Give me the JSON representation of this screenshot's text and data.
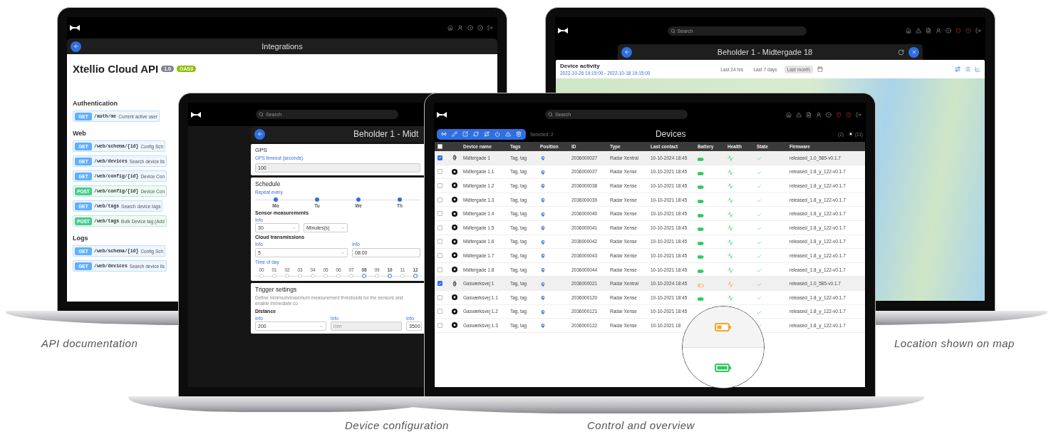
{
  "api_screen": {
    "title": "Integrations",
    "api_name": "Xtellio Cloud API",
    "badges": [
      {
        "text": "1.0",
        "kind": "version"
      },
      {
        "text": "OAS3",
        "kind": "spec"
      }
    ],
    "sections": [
      {
        "title": "Authentication",
        "endpoints": [
          {
            "method": "GET",
            "path": "/auth/me",
            "summary": "Current active user"
          }
        ]
      },
      {
        "title": "Web",
        "endpoints": [
          {
            "method": "GET",
            "path": "/web/schema/{id}",
            "summary": "Config Sch"
          },
          {
            "method": "GET",
            "path": "/web/devices",
            "summary": "Search device lis"
          },
          {
            "method": "GET",
            "path": "/web/config/{id}",
            "summary": "Device Con"
          },
          {
            "method": "POST",
            "path": "/web/config/{id}",
            "summary": "Device Con"
          },
          {
            "method": "GET",
            "path": "/web/tags",
            "summary": "Search device tags"
          },
          {
            "method": "POST",
            "path": "/web/tags",
            "summary": "Bulk Device tag (Add"
          }
        ]
      },
      {
        "title": "Logs",
        "endpoints": [
          {
            "method": "GET",
            "path": "/web/schema/{id}",
            "summary": "Config Sch"
          },
          {
            "method": "GET",
            "path": "/web/devices",
            "summary": "Search device lis"
          }
        ]
      }
    ],
    "caption": "API documentation"
  },
  "config_screen": {
    "search_placeholder": "Search",
    "title": "Beholder 1 - Midt",
    "gps": {
      "heading": "GPS",
      "label": "GPS timeout (seconds)",
      "value": "100",
      "disabled": true
    },
    "schedule": {
      "heading": "Schedule",
      "repeat_label": "Repeat every",
      "days": [
        {
          "label": "Mo",
          "selected": true
        },
        {
          "label": "Tu",
          "selected": true
        },
        {
          "label": "We",
          "selected": true
        },
        {
          "label": "Th",
          "selected": true
        }
      ],
      "sensor_heading": "Sensor measurements",
      "sensor_fields": [
        {
          "label": "Info",
          "value": "30",
          "kind": "select"
        },
        {
          "value": "Minutes(s)",
          "kind": "select"
        }
      ],
      "cloud_heading": "Cloud transmissions",
      "cloud_fields": [
        {
          "label": "Info",
          "value": "5",
          "kind": "select"
        },
        {
          "label": "Info",
          "value": "08:00",
          "kind": "text"
        }
      ],
      "time_label": "Time of day",
      "hours": [
        {
          "label": "00",
          "selected": false
        },
        {
          "label": "01",
          "selected": false
        },
        {
          "label": "02",
          "selected": false
        },
        {
          "label": "03",
          "selected": false
        },
        {
          "label": "04",
          "selected": false
        },
        {
          "label": "05",
          "selected": false
        },
        {
          "label": "06",
          "selected": false
        },
        {
          "label": "07",
          "selected": false
        },
        {
          "label": "08",
          "selected": true
        },
        {
          "label": "09",
          "selected": false
        },
        {
          "label": "10",
          "selected": true
        },
        {
          "label": "11",
          "selected": false
        },
        {
          "label": "12",
          "selected": true
        }
      ]
    },
    "trigger": {
      "heading": "Trigger settings",
      "description": "Define minimum/maximum measurement thresholds for the sensors and enable immediate co",
      "subheading": "Distance",
      "fields": [
        {
          "label": "Info",
          "value": "200",
          "kind": "select"
        },
        {
          "label": "Info",
          "placeholder": "mm",
          "kind": "readonly"
        },
        {
          "label": "Info",
          "value": "3500",
          "kind": "text"
        }
      ]
    },
    "caption": "Device configuration"
  },
  "devices_screen": {
    "search_placeholder": "Search",
    "selected_text": "Selected: 2",
    "title": "Devices",
    "counts": [
      {
        "kind": "central",
        "text": "(2)"
      },
      {
        "kind": "sensor",
        "text": "(11)"
      }
    ],
    "all_selected": false,
    "columns": [
      "Device name",
      "Tags",
      "Position",
      "ID",
      "Type",
      "Last contact",
      "Battery",
      "Health",
      "State",
      "Firmware"
    ],
    "rows": [
      {
        "selected": true,
        "kind": "central",
        "name": "Midtergade 1",
        "tags": "Tag, tag",
        "id": "2036000027",
        "type": "Radar Xentral",
        "last_contact": "10-10-2024 18:45",
        "battery_low": false,
        "health_warning": false,
        "firmware": "released_1.0_585-v0.1.7"
      },
      {
        "selected": false,
        "kind": "sensor",
        "name": "Midtergade 1.1",
        "tags": "Tag, tag",
        "id": "2036000037",
        "type": "Radar Xense",
        "last_contact": "10-10-2021 18:45",
        "battery_low": false,
        "health_warning": false,
        "firmware": "released_1.8_y_122-v0.1.7"
      },
      {
        "selected": false,
        "kind": "sensor",
        "name": "Midtergade 1.2",
        "tags": "Tag, tag",
        "id": "2036000038",
        "type": "Radar Xense",
        "last_contact": "10-10-2021 18:45",
        "battery_low": false,
        "health_warning": false,
        "firmware": "released_1.8_y_122-v0.1.7"
      },
      {
        "selected": false,
        "kind": "sensor",
        "name": "Midtergade 1.3",
        "tags": "Tag, tag",
        "id": "2036000039",
        "type": "Radar Xense",
        "last_contact": "10-10-2021 18:45",
        "battery_low": false,
        "health_warning": false,
        "firmware": "released_1.8_y_122-v0.1.7"
      },
      {
        "selected": false,
        "kind": "sensor",
        "name": "Midtergade 1.4",
        "tags": "Tag, tag",
        "id": "2036000040",
        "type": "Radar Xense",
        "last_contact": "10-10-2021 18:45",
        "battery_low": false,
        "health_warning": false,
        "firmware": "released_1.8_y_122-v0.1.7"
      },
      {
        "selected": false,
        "kind": "sensor",
        "name": "Midtergade 1.5",
        "tags": "Tag, tag",
        "id": "2036000041",
        "type": "Radar Xense",
        "last_contact": "10-10-2021 18:45",
        "battery_low": false,
        "health_warning": false,
        "firmware": "released_1.8_y_122-v0.1.7"
      },
      {
        "selected": false,
        "kind": "sensor",
        "name": "Midtergade 1.6",
        "tags": "Tag, tag",
        "id": "2036000042",
        "type": "Radar Xense",
        "last_contact": "10-10-2021 18:45",
        "battery_low": false,
        "health_warning": false,
        "firmware": "released_1.8_y_122-v0.1.7"
      },
      {
        "selected": false,
        "kind": "sensor",
        "name": "Midtergade 1.7",
        "tags": "Tag, tag",
        "id": "2036000043",
        "type": "Radar Xense",
        "last_contact": "10-10-2021 18:45",
        "battery_low": false,
        "health_warning": false,
        "firmware": "released_1.8_y_122-v0.1.7"
      },
      {
        "selected": false,
        "kind": "sensor",
        "name": "Midtergade 1.8",
        "tags": "Tag, tag",
        "id": "2036000044",
        "type": "Radar Xense",
        "last_contact": "10-10-2021 18:45",
        "battery_low": false,
        "health_warning": false,
        "firmware": "released_1.8_y_122-v0.1.7"
      },
      {
        "selected": true,
        "kind": "central",
        "name": "Gasværksvej 1",
        "tags": "Tag, tag",
        "id": "2036000021",
        "type": "Radar Xentral",
        "last_contact": "10-10-2024 18:45",
        "battery_low": true,
        "health_warning": true,
        "firmware": "released_1.0_585-v0.1.7"
      },
      {
        "selected": false,
        "kind": "sensor",
        "name": "Gasværksvej 1.1",
        "tags": "Tag, tag",
        "id": "2036000120",
        "type": "Radar Xense",
        "last_contact": "10-10-2021 18:45",
        "battery_low": false,
        "health_warning": false,
        "firmware": "released_1.8_y_122-v0.1.7"
      },
      {
        "selected": false,
        "kind": "sensor",
        "name": "Gasværksvej 1.2",
        "tags": "Tag, tag",
        "id": "2036000121",
        "type": "Radar Xense",
        "last_contact": "10-10-2021 18:45",
        "firmware": "released_1.8_y_122-v0.1.7"
      },
      {
        "selected": false,
        "kind": "sensor",
        "name": "Gasværksvej 1.3",
        "tags": "Tag, tag",
        "id": "2036000122",
        "type": "Radar Xense",
        "last_contact": "10-10-2021 18",
        "firmware": "released_1.8_y_122-v0.1.7"
      }
    ],
    "magnifier": [
      {
        "battery_low": true
      },
      {
        "battery_low": false
      }
    ],
    "caption": "Control and overview"
  },
  "map_screen": {
    "search_placeholder": "Search",
    "title": "Beholder 1 - Midtergade 18",
    "card_title": "Device activity",
    "date_range": "2022-10-26 19:15:00 - 2022-10-18 19:15:00",
    "ranges": [
      {
        "label": "Last 24 hrs",
        "selected": false
      },
      {
        "label": "Last 7 days",
        "selected": false
      },
      {
        "label": "Last month",
        "selected": true
      }
    ],
    "caption": "Location shown on map"
  }
}
